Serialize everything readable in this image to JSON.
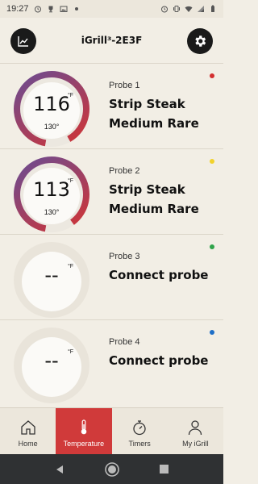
{
  "status_bar": {
    "time": "19:27",
    "icons": [
      "alarm-icon",
      "trophy-icon",
      "photo-icon",
      "signal-dot",
      "alarm-icon",
      "vibrate-icon",
      "wifi-icon",
      "cellular-icon",
      "battery-icon"
    ]
  },
  "header": {
    "title": "iGrill³-2E3F",
    "left_icon": "chart-icon",
    "right_icon": "gear-icon"
  },
  "probes": [
    {
      "label": "Probe 1",
      "name": "Strip Steak Medium Rare",
      "temp": "116",
      "unit": "°F",
      "target": "130°",
      "dot_color": "#d32f2f",
      "progress": 0.89,
      "active": true
    },
    {
      "label": "Probe 2",
      "name": "Strip Steak Medium Rare",
      "temp": "113",
      "unit": "°F",
      "target": "130°",
      "dot_color": "#f2d22b",
      "progress": 0.87,
      "active": true
    },
    {
      "label": "Probe 3",
      "name": "Connect probe",
      "temp": "--",
      "unit": "°F",
      "target": "",
      "dot_color": "#2fa34a",
      "progress": 0,
      "active": false
    },
    {
      "label": "Probe 4",
      "name": "Connect probe",
      "temp": "--",
      "unit": "°F",
      "target": "",
      "dot_color": "#1f6fc7",
      "progress": 0,
      "active": false
    }
  ],
  "nav": {
    "items": [
      {
        "label": "Home",
        "icon": "home-icon",
        "active": false
      },
      {
        "label": "Temperature",
        "icon": "thermometer-icon",
        "active": true
      },
      {
        "label": "Timers",
        "icon": "stopwatch-icon",
        "active": false
      },
      {
        "label": "My iGrill",
        "icon": "person-icon",
        "active": false
      }
    ]
  },
  "colors": {
    "accent": "#d03a3a",
    "gauge_start": "#6a4c93",
    "gauge_end": "#d23434",
    "background": "#f2eee5"
  }
}
